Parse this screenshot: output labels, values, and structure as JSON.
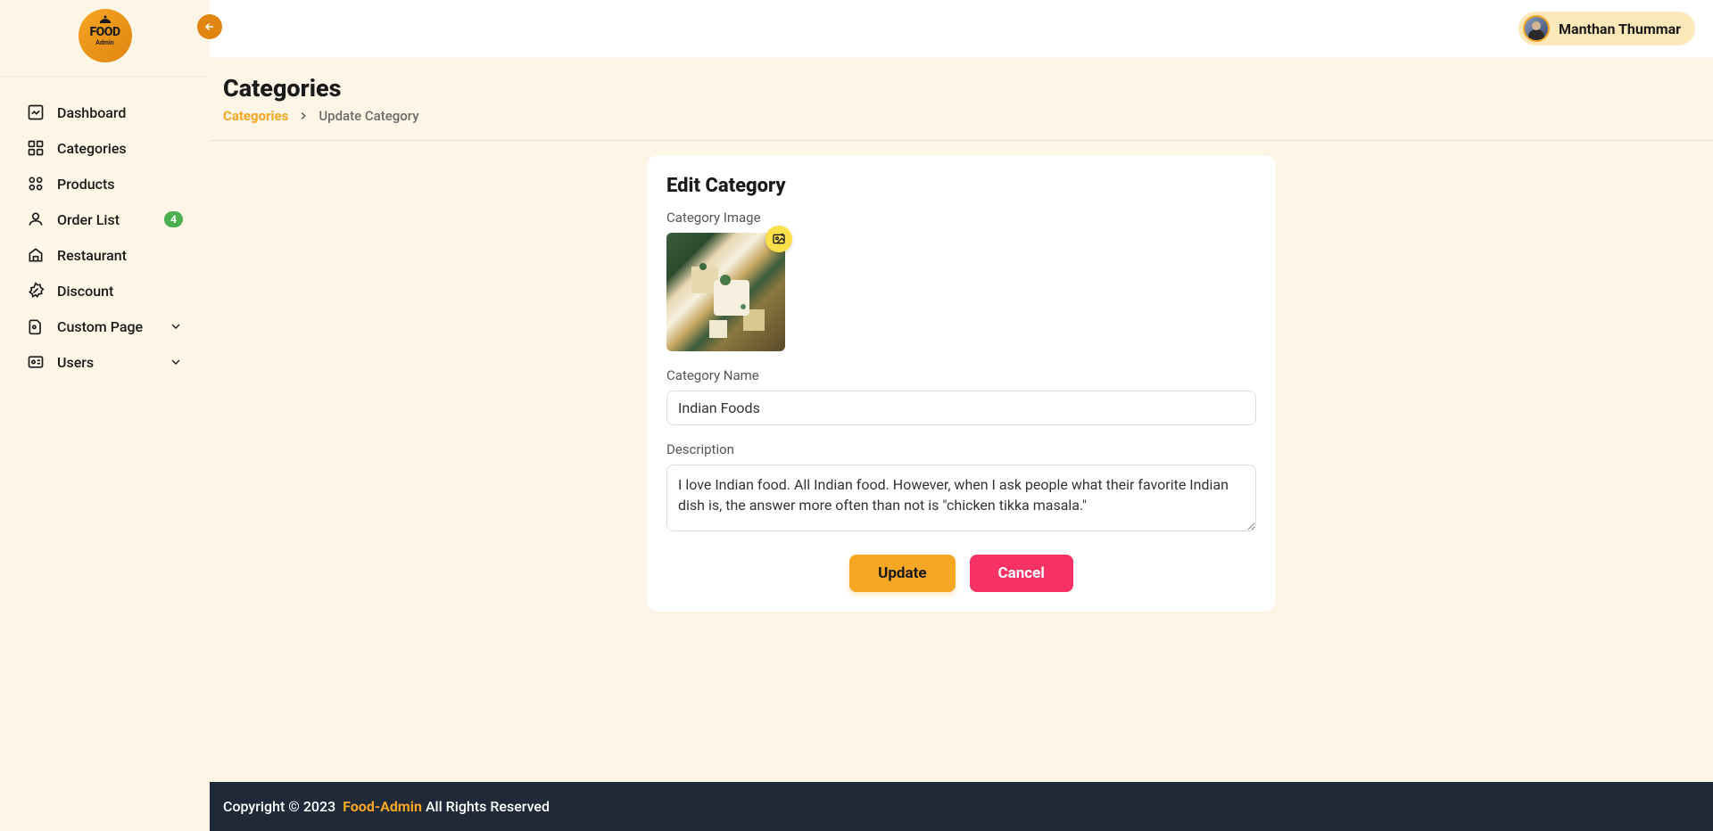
{
  "logo": {
    "main": "FOOD",
    "sub": "Admin"
  },
  "sidebar": {
    "items": [
      {
        "label": "Dashboard",
        "icon": "dashboard"
      },
      {
        "label": "Categories",
        "icon": "categories"
      },
      {
        "label": "Products",
        "icon": "products"
      },
      {
        "label": "Order List",
        "icon": "orders",
        "badge": "4"
      },
      {
        "label": "Restaurant",
        "icon": "restaurant"
      },
      {
        "label": "Discount",
        "icon": "discount"
      },
      {
        "label": "Custom Page",
        "icon": "custom",
        "hasChevron": true
      },
      {
        "label": "Users",
        "icon": "users",
        "hasChevron": true
      }
    ]
  },
  "header": {
    "username": "Manthan Thummar"
  },
  "page": {
    "title": "Categories",
    "breadcrumb": {
      "root": "Categories",
      "current": "Update Category"
    }
  },
  "form": {
    "title": "Edit Category",
    "labels": {
      "image": "Category Image",
      "name": "Category Name",
      "description": "Description"
    },
    "values": {
      "name": "Indian Foods",
      "description": "I love Indian food. All Indian food. However, when I ask people what their favorite Indian dish is, the answer more often than not is \"chicken tikka masala.\""
    },
    "buttons": {
      "update": "Update",
      "cancel": "Cancel"
    }
  },
  "footer": {
    "copyright": "Copyright © 2023",
    "brand": "Food-Admin",
    "rights": "All Rights Reserved"
  }
}
